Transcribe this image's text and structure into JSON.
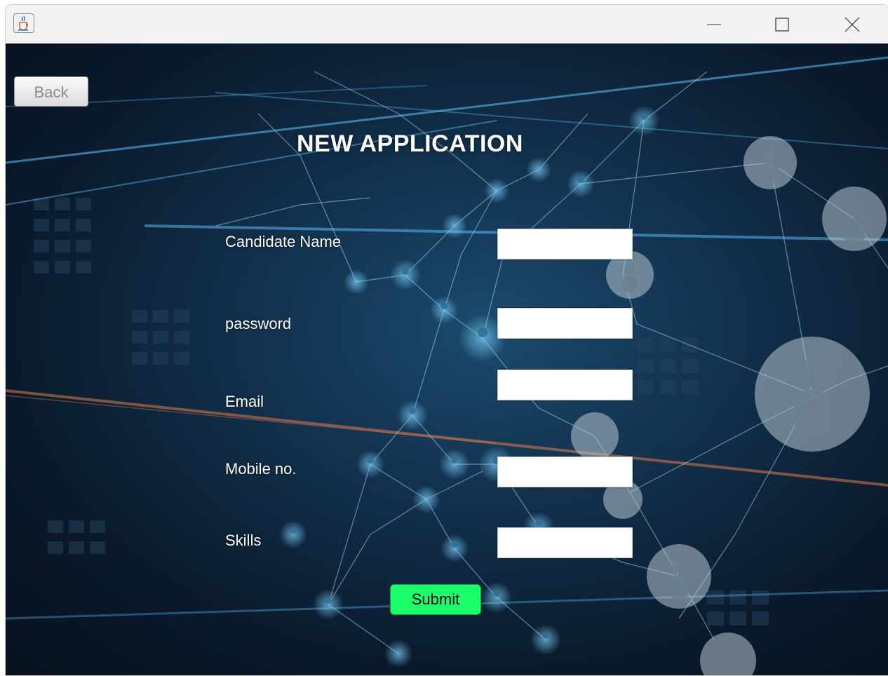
{
  "window": {
    "app_icon": "java-cup-icon",
    "controls": {
      "minimize": "minimize-icon",
      "maximize": "maximize-icon",
      "close": "close-icon"
    }
  },
  "toolbar": {
    "back_label": "Back"
  },
  "form": {
    "title": "NEW APPLICATION",
    "fields": [
      {
        "label": "Candidate Name",
        "value": ""
      },
      {
        "label": "password",
        "value": ""
      },
      {
        "label": "Email",
        "value": ""
      },
      {
        "label": "Mobile no.",
        "value": ""
      },
      {
        "label": "Skills",
        "value": ""
      }
    ],
    "submit_label": "Submit"
  },
  "colors": {
    "background": "#0a1a2c",
    "network_line": "#5fc4ff",
    "accent_line": "#e07a4a",
    "submit": "#1aff6a"
  }
}
